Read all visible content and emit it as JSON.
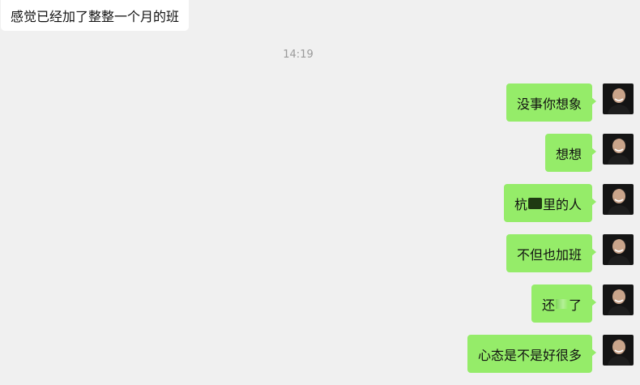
{
  "incoming": {
    "text": "感觉已经加了整整一个月的班"
  },
  "timestamp": "14:19",
  "messages": [
    {
      "text": "没事你想象"
    },
    {
      "text": "想想"
    },
    {
      "text_before": "杭",
      "text_after": "里的人"
    },
    {
      "text": "不但也加班"
    },
    {
      "text_before": "还",
      "text_after": "了"
    },
    {
      "text": "心态是不是好很多"
    }
  ],
  "colors": {
    "background": "#f0f0f0",
    "incoming_bubble": "#ffffff",
    "outgoing_bubble": "#95ec69",
    "timestamp_text": "#9a9a9a",
    "avatar_bg": "#141414"
  }
}
